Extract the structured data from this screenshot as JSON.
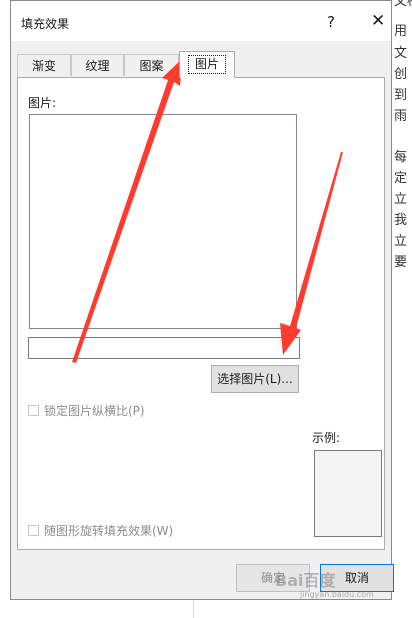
{
  "background_doc": {
    "chars": [
      "文档",
      "用",
      "文",
      "创",
      "到",
      "雨",
      "每",
      "定",
      "立",
      "我",
      "立",
      "要"
    ]
  },
  "dialog": {
    "title": "填充效果",
    "help_glyph": "?",
    "close_glyph": "✕"
  },
  "tabs": [
    {
      "label": "渐变"
    },
    {
      "label": "纹理"
    },
    {
      "label": "图案"
    },
    {
      "label": "图片"
    }
  ],
  "picture_panel": {
    "picture_label": "图片:",
    "filename_value": "",
    "select_button": "选择图片(L)...",
    "lock_aspect_label": "锁定图片纵横比(P)",
    "sample_label": "示例:",
    "rotate_label": "随图形旋转填充效果(W)"
  },
  "footer": {
    "ok": "确定",
    "cancel": "取消"
  },
  "watermark": {
    "text": "Bai百度",
    "sub": "jingyan.baidu.com"
  },
  "colors": {
    "annotation_arrow": "#ff3b2f",
    "focus_border": "#0078d7"
  }
}
